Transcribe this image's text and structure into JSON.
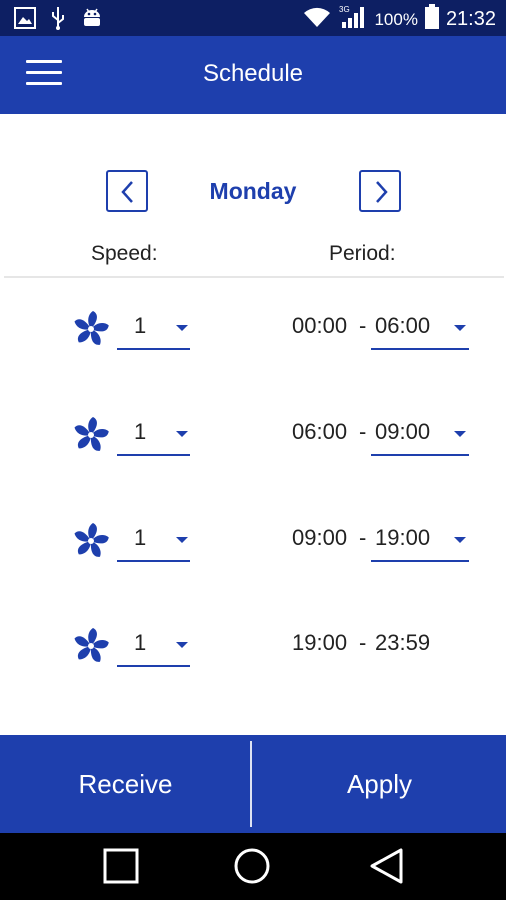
{
  "status_bar": {
    "battery_percent": "100%",
    "time": "21:32",
    "network": "3G",
    "icons": [
      "image-icon",
      "usb-icon",
      "android-icon",
      "wifi-icon",
      "signal-icon",
      "battery-icon"
    ]
  },
  "app_bar": {
    "title": "Schedule",
    "menu_icon": "hamburger-menu-icon"
  },
  "day_nav": {
    "day": "Monday",
    "prev_icon": "chevron-left-icon",
    "next_icon": "chevron-right-icon"
  },
  "columns": {
    "speed": "Speed:",
    "period": "Period:"
  },
  "rows": [
    {
      "speed": "1",
      "from": "00:00",
      "sep": "-",
      "to": "06:00",
      "to_editable": true
    },
    {
      "speed": "1",
      "from": "06:00",
      "sep": "-",
      "to": "09:00",
      "to_editable": true
    },
    {
      "speed": "1",
      "from": "09:00",
      "sep": "-",
      "to": "19:00",
      "to_editable": true
    },
    {
      "speed": "1",
      "from": "19:00",
      "sep": "-",
      "to": "23:59",
      "to_editable": false
    }
  ],
  "buttons": {
    "receive": "Receive",
    "apply": "Apply"
  },
  "colors": {
    "primary": "#1e3fad",
    "status_bar": "#0d1f63",
    "navigation_bar": "#000000"
  }
}
